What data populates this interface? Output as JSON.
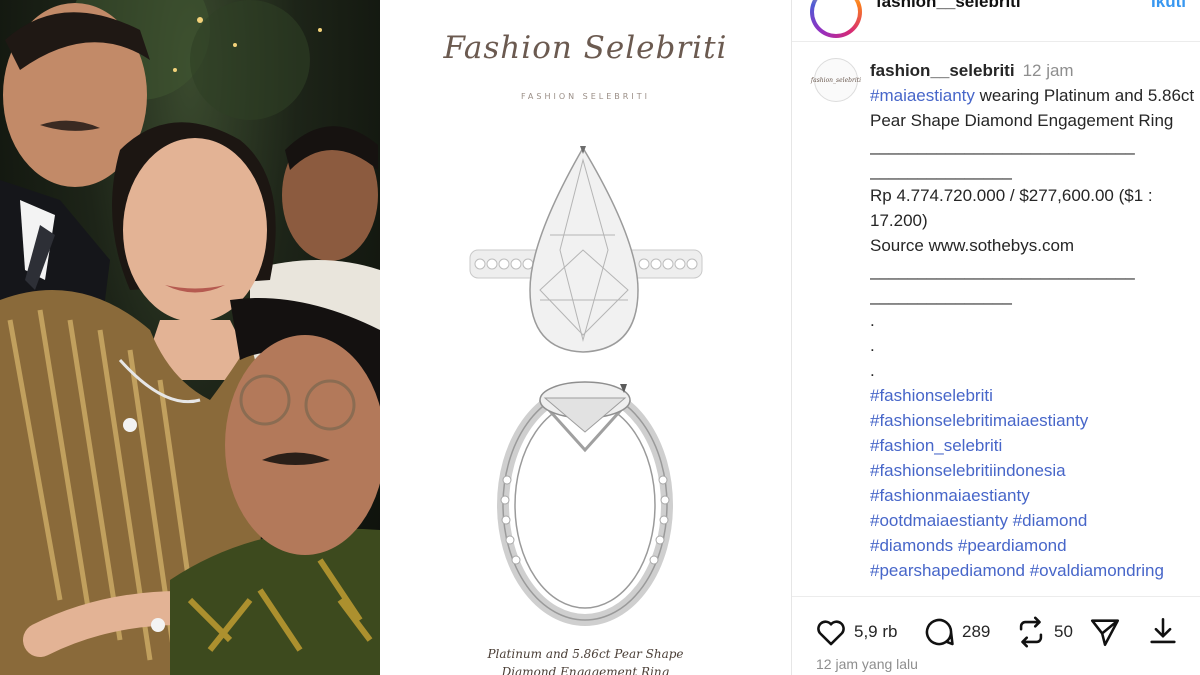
{
  "header": {
    "username": "fashion__selebriti",
    "follow_label": "Ikuti"
  },
  "post_image": {
    "brand_script": "Fashion Selebriti",
    "brand_small": "FASHION SELEBRITI",
    "caption_line1": "Platinum and 5.86ct Pear Shape",
    "caption_line2": "Diamond Engagement Ring"
  },
  "comment": {
    "avatar_text": "fashion_selebriti",
    "username": "fashion__selebriti",
    "time": "12 jam",
    "mention_tag": "#maiaestianty",
    "text_1": " wearing Platinum and 5.86ct Pear Shape Diamond Engagement Ring",
    "divider_a": "____________________________",
    "divider_b": "_______________",
    "price": "Rp 4.774.720.000 / $277,600.00 ($1 : 17.200)",
    "source": "Source www.sothebys.com",
    "divider_c": "____________________________",
    "divider_d": "_______________",
    "dot": ".",
    "hashtags": [
      "#fashionselebriti",
      "#fashionselebritimaiaestianty",
      "#fashion_selebriti",
      "#fashionselebritiindonesia",
      "#fashionmaiaestianty",
      "#ootdmaiaestianty #diamond",
      "#diamonds #peardiamond",
      "#pearshapediamond #ovaldiamondring"
    ]
  },
  "actions": {
    "like_icon": "heart-icon",
    "likes": "5,9 rb",
    "comment_icon": "comment-icon",
    "comments": "289",
    "repost_icon": "repost-icon",
    "reposts": "50",
    "share_icon": "send-icon",
    "save_icon": "download-icon"
  },
  "timestamp": "12 jam yang lalu",
  "colors": {
    "hashtag": "#4766c9",
    "follow": "#3897f0",
    "text": "#262626",
    "muted": "#8e8e8e"
  }
}
